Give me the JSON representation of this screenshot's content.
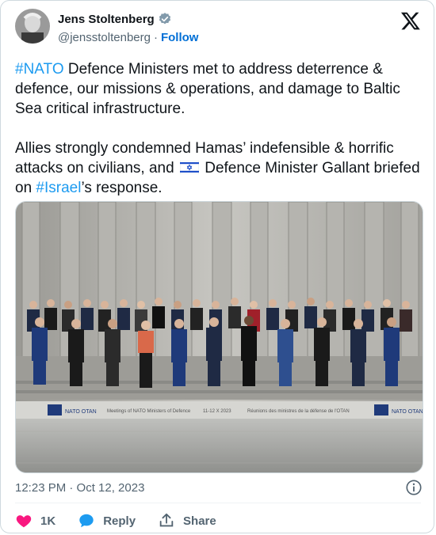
{
  "author": {
    "display_name": "Jens Stoltenberg",
    "handle": "@jensstoltenberg",
    "separator": "·",
    "follow_label": "Follow"
  },
  "tweet": {
    "p1_hashtag": "#NATO",
    "p1_text": " Defence Ministers met to address deterrence & defence, our missions & operations, and damage to Baltic Sea critical infrastructure.",
    "p2_text_a": "Allies strongly condemned Hamas’ indefensible & horrific attacks on civilians, and ",
    "p2_text_b": " Defence Minister Gallant briefed on ",
    "p2_hashtag": "#Israel",
    "p2_text_c": "’s response."
  },
  "photo": {
    "banner_text_left": "Meetings of NATO Ministers of Defence",
    "banner_text_mid": "11-12 X 2023",
    "banner_text_right": "Réunions des ministres de la défense de l'OTAN",
    "logo_text": "NATO OTAN"
  },
  "meta": {
    "timestamp": "12:23 PM · Oct 12, 2023"
  },
  "actions": {
    "like_count": "1K",
    "reply_label": "Reply",
    "share_label": "Share"
  },
  "colors": {
    "link": "#1d9bf0",
    "follow": "#006fd6",
    "like": "#f91880",
    "reply": "#1d9bf0",
    "muted": "#536471"
  }
}
